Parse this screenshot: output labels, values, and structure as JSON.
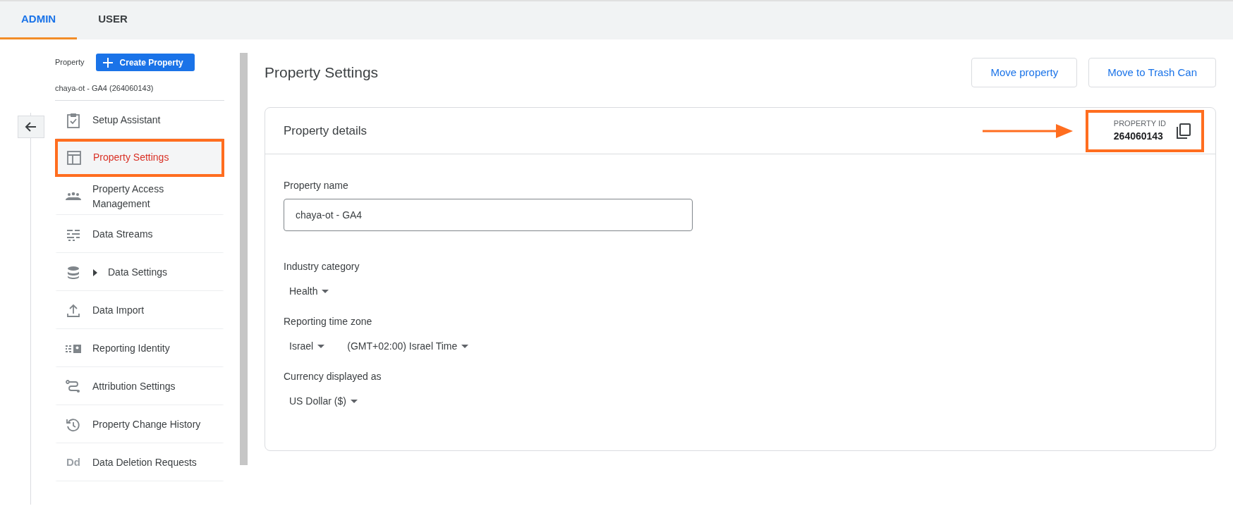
{
  "tabs": [
    {
      "label": "ADMIN",
      "selected": true
    },
    {
      "label": "USER",
      "selected": false
    }
  ],
  "sidebar": {
    "property_label": "Property",
    "create_button": "Create Property",
    "account": "chaya-ot - GA4 (264060143)",
    "items": [
      {
        "label": "Setup Assistant",
        "selected": false,
        "highlighted": false
      },
      {
        "label": "Property Settings",
        "selected": true,
        "highlighted": true
      },
      {
        "label": "Property Access Management",
        "selected": false,
        "highlighted": false
      },
      {
        "label": "Data Streams",
        "selected": false,
        "highlighted": false
      },
      {
        "label": "Data Settings",
        "selected": false,
        "highlighted": false,
        "expanded": false
      },
      {
        "label": "Data Import",
        "selected": false,
        "highlighted": false
      },
      {
        "label": "Reporting Identity",
        "selected": false,
        "highlighted": false
      },
      {
        "label": "Attribution Settings",
        "selected": false,
        "highlighted": false
      },
      {
        "label": "Property Change History",
        "selected": false,
        "highlighted": false
      },
      {
        "label": "Data Deletion Requests",
        "selected": false,
        "highlighted": false,
        "icon_text": "Dd"
      }
    ]
  },
  "page": {
    "title": "Property Settings",
    "buttons": [
      "Move property",
      "Move to Trash Can"
    ]
  },
  "card": {
    "title": "Property details",
    "annotation_arrow": true,
    "property_id": {
      "label": "PROPERTY ID",
      "value": "264060143",
      "highlighted": true
    },
    "fields": [
      {
        "kind": "text",
        "label": "Property name",
        "value": "chaya-ot - GA4"
      },
      {
        "kind": "dropdown",
        "label": "Industry category",
        "options": [
          "Health"
        ]
      },
      {
        "kind": "dropdown",
        "label": "Reporting time zone",
        "options": [
          "Israel",
          "(GMT+02:00) Israel Time"
        ]
      },
      {
        "kind": "dropdown",
        "label": "Currency displayed as",
        "options": [
          "US Dollar ($)"
        ]
      }
    ]
  }
}
